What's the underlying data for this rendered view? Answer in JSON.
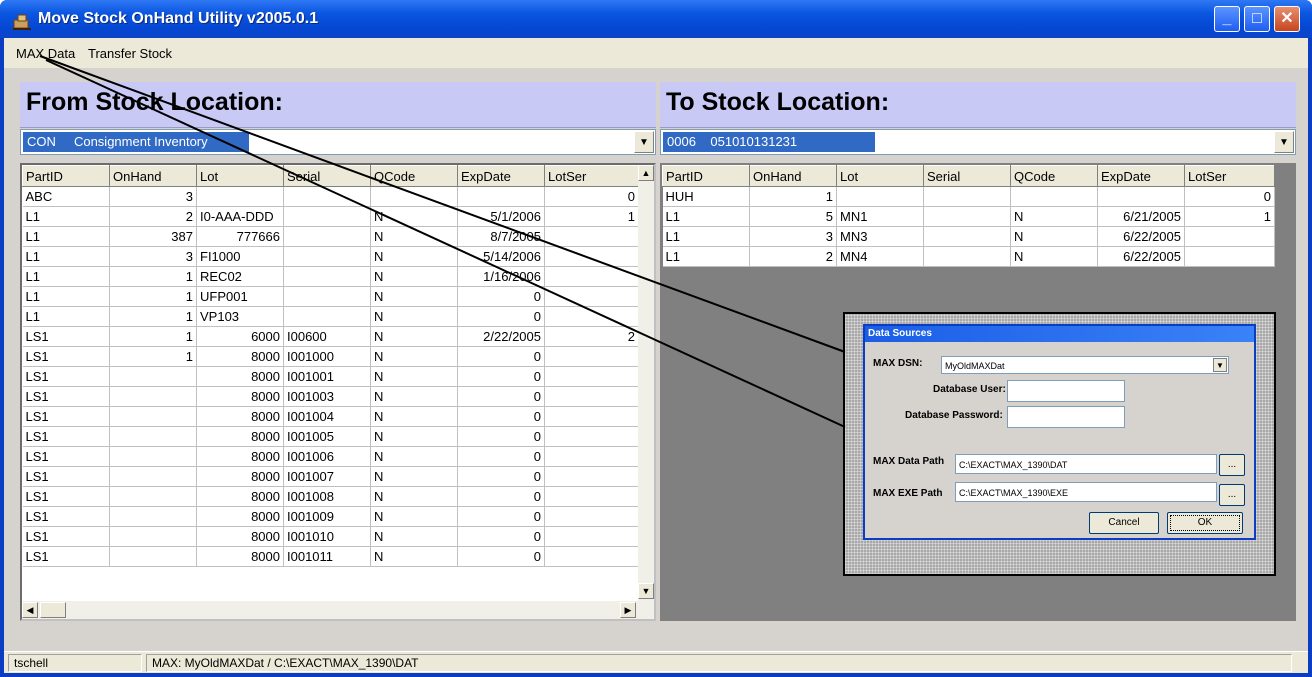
{
  "window": {
    "title": "Move Stock OnHand Utility v2005.0.1",
    "minimize": "_",
    "maximize": "□",
    "close": "✕"
  },
  "menu": {
    "items": [
      "MAX Data",
      "Transfer Stock"
    ]
  },
  "from": {
    "title": "From Stock Location:",
    "location_code": "CON",
    "location_name": "Consignment Inventory",
    "columns": [
      "PartID",
      "OnHand",
      "Lot",
      "Serial",
      "QCode",
      "ExpDate",
      "LotSer"
    ],
    "rows": [
      [
        "ABC",
        "3",
        "",
        "",
        "",
        "",
        "0"
      ],
      [
        "L1",
        "2",
        "I0-AAA-DDD",
        "",
        "N",
        "5/1/2006",
        "1"
      ],
      [
        "L1",
        "387",
        "777666",
        "",
        "N",
        "8/7/2005",
        ""
      ],
      [
        "L1",
        "3",
        "FI1000",
        "",
        "N",
        "5/14/2006",
        ""
      ],
      [
        "L1",
        "1",
        "REC02",
        "",
        "N",
        "1/16/2006",
        ""
      ],
      [
        "L1",
        "1",
        "UFP001",
        "",
        "N",
        "0",
        ""
      ],
      [
        "L1",
        "1",
        "VP103",
        "",
        "N",
        "0",
        ""
      ],
      [
        "LS1",
        "1",
        "6000",
        "I00600",
        "N",
        "2/22/2005",
        "2"
      ],
      [
        "LS1",
        "1",
        "8000",
        "I001000",
        "N",
        "0",
        ""
      ],
      [
        "LS1",
        "",
        "8000",
        "I001001",
        "N",
        "0",
        ""
      ],
      [
        "LS1",
        "",
        "8000",
        "I001003",
        "N",
        "0",
        ""
      ],
      [
        "LS1",
        "",
        "8000",
        "I001004",
        "N",
        "0",
        ""
      ],
      [
        "LS1",
        "",
        "8000",
        "I001005",
        "N",
        "0",
        ""
      ],
      [
        "LS1",
        "",
        "8000",
        "I001006",
        "N",
        "0",
        ""
      ],
      [
        "LS1",
        "",
        "8000",
        "I001007",
        "N",
        "0",
        ""
      ],
      [
        "LS1",
        "",
        "8000",
        "I001008",
        "N",
        "0",
        ""
      ],
      [
        "LS1",
        "",
        "8000",
        "I001009",
        "N",
        "0",
        ""
      ],
      [
        "LS1",
        "",
        "8000",
        "I001010",
        "N",
        "0",
        ""
      ],
      [
        "LS1",
        "",
        "8000",
        "I001011",
        "N",
        "0",
        ""
      ]
    ]
  },
  "to": {
    "title": "To Stock Location:",
    "location_code": "0006",
    "location_name": "051010131231",
    "columns": [
      "PartID",
      "OnHand",
      "Lot",
      "Serial",
      "QCode",
      "ExpDate",
      "LotSer"
    ],
    "rows": [
      [
        "HUH",
        "1",
        "",
        "",
        "",
        "",
        "0"
      ],
      [
        "L1",
        "5",
        "MN1",
        "",
        "N",
        "6/21/2005",
        "1"
      ],
      [
        "L1",
        "3",
        "MN3",
        "",
        "N",
        "6/22/2005",
        ""
      ],
      [
        "L1",
        "2",
        "MN4",
        "",
        "N",
        "6/22/2005",
        ""
      ]
    ]
  },
  "dialog": {
    "title": "Data Sources",
    "dsn_label": "MAX DSN:",
    "dsn_value": "MyOldMAXDat",
    "user_label": "Database User:",
    "user_value": "",
    "password_label": "Database Password:",
    "password_value": "",
    "data_path_label": "MAX Data Path",
    "data_path_value": "C:\\EXACT\\MAX_1390\\DAT",
    "exe_path_label": "MAX EXE Path",
    "exe_path_value": "C:\\EXACT\\MAX_1390\\EXE",
    "browse_label": "...",
    "cancel_label": "Cancel",
    "ok_label": "OK"
  },
  "status": {
    "user": "tschell",
    "connection": "MAX: MyOldMAXDat / C:\\EXACT\\MAX_1390\\DAT"
  },
  "colors": {
    "title_bar": "#0b56e0",
    "panel_header": "#c9c9f6",
    "selection": "#316ac5",
    "client": "#d6d3ce"
  }
}
